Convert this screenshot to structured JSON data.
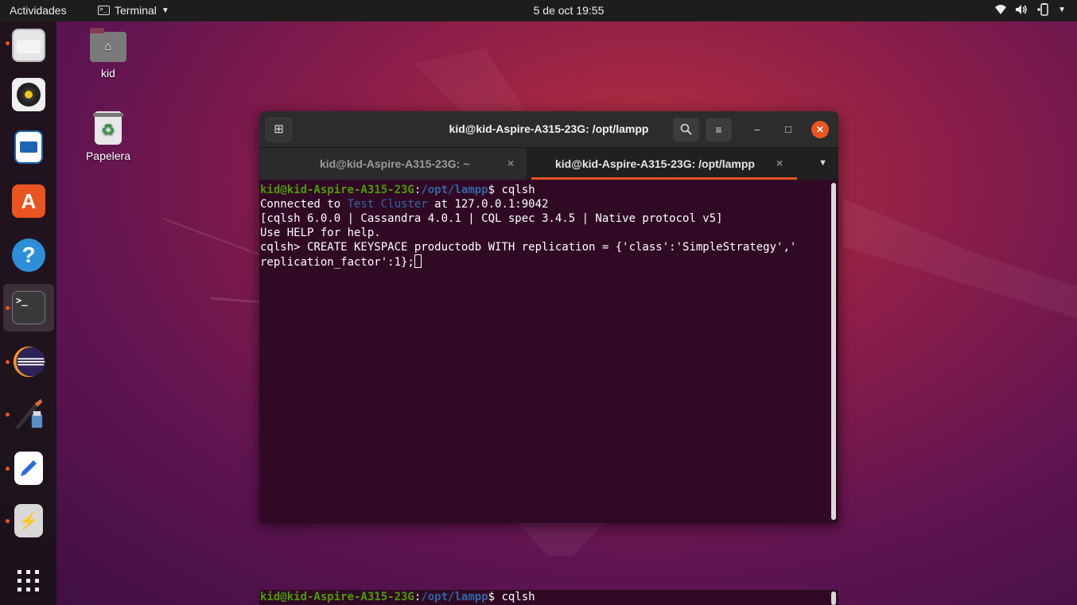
{
  "topbar": {
    "activities": "Actividades",
    "app_name": "Terminal",
    "clock": "5 de oct  19:55",
    "status_icons": [
      "wifi-icon",
      "volume-icon",
      "battery-icon",
      "system-menu-caret"
    ]
  },
  "dock": {
    "items": [
      {
        "name": "files",
        "icon": "folder-icon",
        "running": true
      },
      {
        "name": "rhythmbox",
        "icon": "speaker-icon",
        "running": false
      },
      {
        "name": "libreoffice-writer",
        "icon": "document-icon",
        "running": false
      },
      {
        "name": "ubuntu-software",
        "icon": "shopping-bag-icon",
        "running": false
      },
      {
        "name": "help",
        "icon": "question-icon",
        "running": false
      },
      {
        "name": "terminal",
        "icon": "terminal-icon",
        "running": true,
        "active": true
      },
      {
        "name": "eclipse",
        "icon": "eclipse-icon",
        "running": true
      },
      {
        "name": "inkscape",
        "icon": "pen-icon",
        "running": true
      },
      {
        "name": "text-editor",
        "icon": "text-editor-icon",
        "running": true
      },
      {
        "name": "usb",
        "icon": "usb-icon",
        "running": true
      },
      {
        "name": "show-applications",
        "icon": "grid-icon",
        "running": false
      }
    ]
  },
  "desktop": {
    "home_label": "kid",
    "trash_label": "Papelera"
  },
  "terminal": {
    "title": "kid@kid-Aspire-A315-23G: /opt/lampp",
    "tabs": [
      {
        "label": "kid@kid-Aspire-A315-23G: ~",
        "active": false
      },
      {
        "label": "kid@kid-Aspire-A315-23G: /opt/lampp",
        "active": true
      }
    ],
    "close_glyph": "×",
    "prompt_user": "kid@kid-Aspire-A315-23G",
    "prompt_path": "/opt/lampp",
    "lines": {
      "l1_cmd": "$ cqlsh",
      "l2_pre": "Connected to ",
      "l2_cluster": "Test Cluster",
      "l2_post": " at 127.0.0.1:9042",
      "l3": "[cqlsh 6.0.0 | Cassandra 4.0.1 | CQL spec 3.4.5 | Native protocol v5]",
      "l4": "Use HELP for help.",
      "l5": "cqlsh> CREATE KEYSPACE productodb WITH replication = {'class':'SimpleStrategy','",
      "l6": "replication_factor':1};"
    }
  },
  "bottom_terminal": {
    "prompt_user": "kid@kid-Aspire-A315-23G",
    "prompt_path": "/opt/lampp",
    "cmd": "$ cqlsh"
  },
  "colors": {
    "accent": "#e95420",
    "terminal_bg": "#300a24",
    "prompt_green": "#4e9a06",
    "prompt_blue": "#3465a4"
  }
}
